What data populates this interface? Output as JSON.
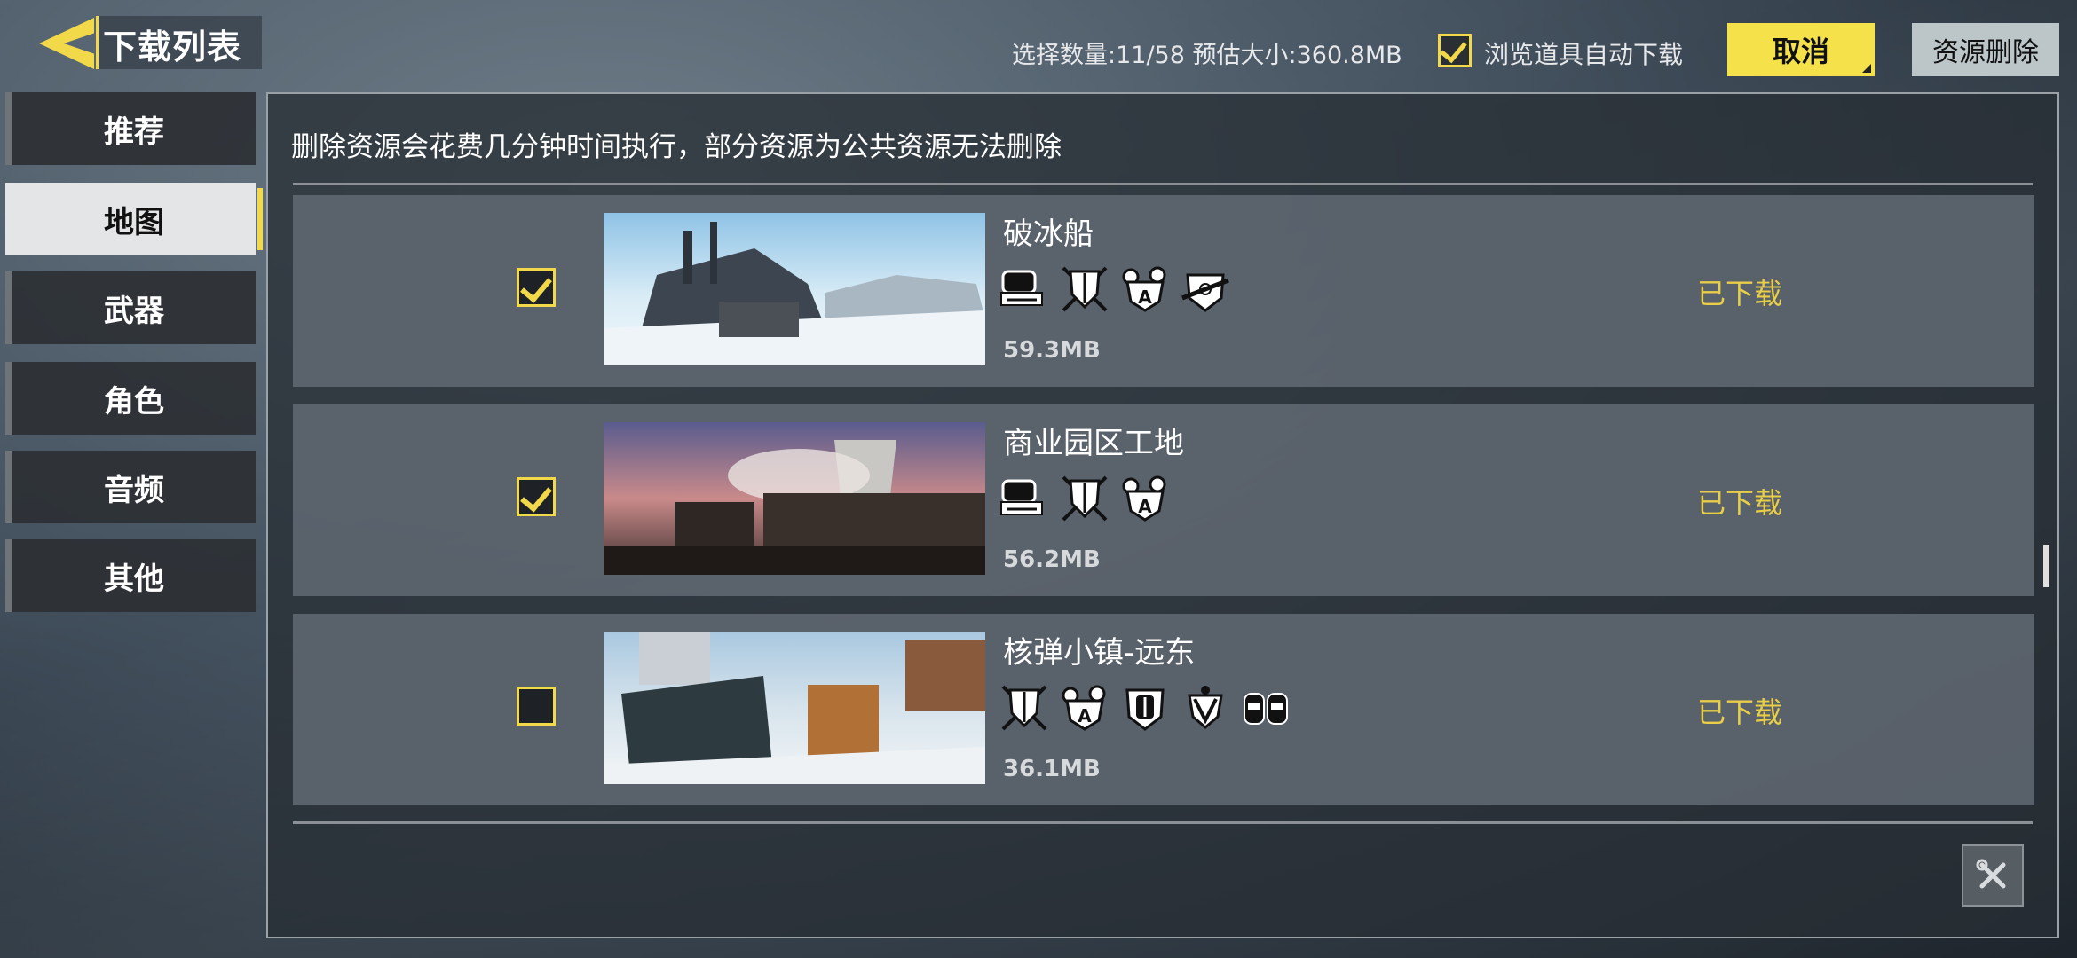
{
  "header": {
    "title": "下载列表",
    "selection_info": "选择数量:11/58 预估大小:360.8MB",
    "auto_download_label": "浏览道具自动下载",
    "auto_download_checked": true,
    "cancel_label": "取消",
    "delete_label": "资源删除"
  },
  "sidebar": {
    "items": [
      {
        "label": "推荐",
        "active": false
      },
      {
        "label": "地图",
        "active": true
      },
      {
        "label": "武器",
        "active": false
      },
      {
        "label": "角色",
        "active": false
      },
      {
        "label": "音频",
        "active": false
      },
      {
        "label": "其他",
        "active": false
      }
    ]
  },
  "main": {
    "notice": "删除资源会花费几分钟时间执行，部分资源为公共资源无法删除",
    "rows": [
      {
        "name": "破冰船",
        "size": "59.3MB",
        "status": "已下载",
        "checked": true,
        "mode_icons": [
          "tank-battle-icon",
          "shield-swords-icon",
          "domination-a-icon",
          "sniper-crest-icon"
        ]
      },
      {
        "name": "商业园区工地",
        "size": "56.2MB",
        "status": "已下载",
        "checked": true,
        "mode_icons": [
          "tank-battle-icon",
          "shield-swords-icon",
          "domination-a-icon"
        ]
      },
      {
        "name": "核弹小镇-远东",
        "size": "36.1MB",
        "status": "已下载",
        "checked": false,
        "mode_icons": [
          "shield-swords-icon",
          "domination-a-icon",
          "fist-crest-icon",
          "chevron-crest-icon",
          "gloves-icon"
        ]
      }
    ]
  },
  "colors": {
    "accent": "#f2d94a",
    "status": "#e9cf47",
    "panel": "#2e343a"
  }
}
